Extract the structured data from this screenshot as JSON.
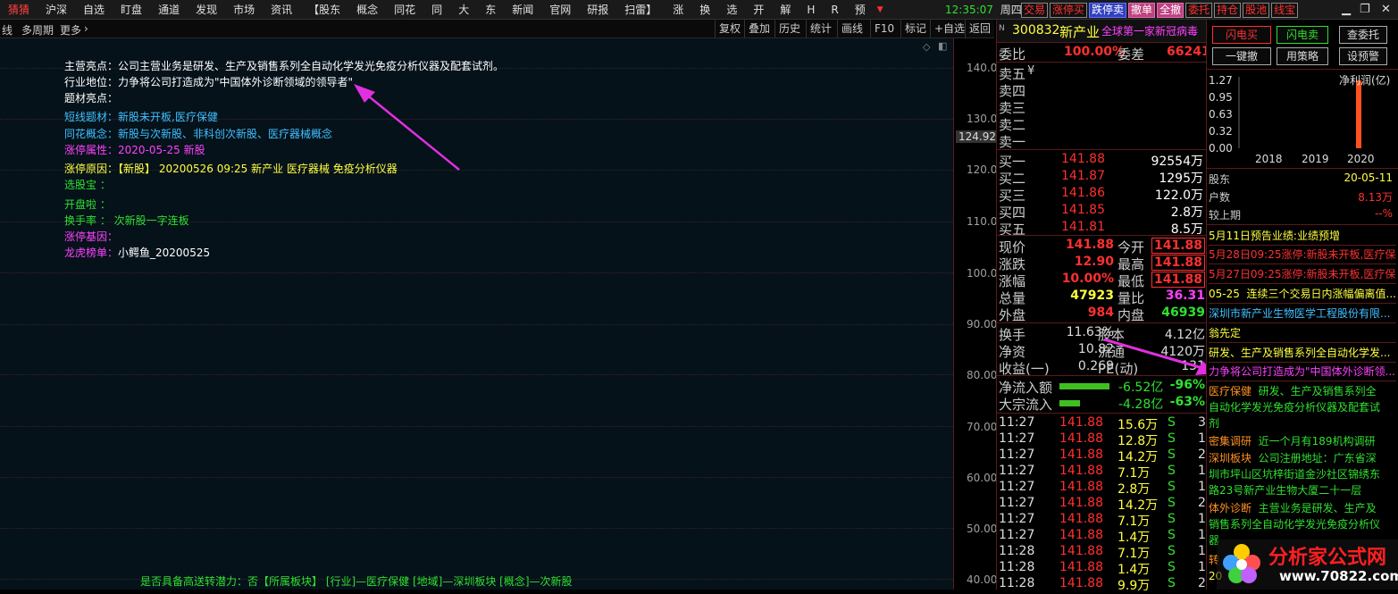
{
  "menu": {
    "items": [
      "猜猜",
      "沪深",
      "自选",
      "盯盘",
      "通道",
      "发现",
      "市场",
      "资讯",
      "【股东",
      "概念",
      "同花",
      "同",
      "大",
      "东",
      "新闻",
      "官网",
      "研报",
      "扫雷】",
      "涨",
      "换",
      "选",
      "开",
      "解",
      "H",
      "R",
      "预"
    ],
    "arrow": "▼"
  },
  "clock": {
    "time": "12:35:07",
    "weekday": "周四"
  },
  "rbuttons": [
    "交易",
    "涨停买",
    "跌停卖",
    "撤单",
    "全撤",
    "委托",
    "持仓",
    "股池",
    "线宝"
  ],
  "window": {
    "min": "▁",
    "restore": "❐",
    "close": "✕"
  },
  "toolbar": {
    "left": [
      "线",
      "多周期",
      "更多",
      "›"
    ],
    "right": [
      "复权",
      "叠加",
      "历史",
      "统计",
      "画线",
      "F10",
      "标记",
      "+自选",
      "返回"
    ]
  },
  "info": {
    "l1": "主营亮点：公司主营业务是研发、生产及销售系列全自动化学发光免疫分析仪器及配套试剂。",
    "l2": "行业地位：力争将公司打造成为\"中国体外诊断领域的领导者\"",
    "l3": "题材亮点：",
    "l4a": "短线题材：",
    "l4b": "新股未开板,医疗保健",
    "l5a": "同花概念：",
    "l5b": "新股与次新股、非科创次新股、医疗器械概念",
    "l6a": "涨停属性：",
    "l6b": "2020-05-25 新股",
    "l7a": "涨停原因：",
    "l7b": "【新股】 20200526 09:25 新产业  医疗器械 免疫分析仪器",
    "l8": "选股宝 ：",
    "l9": "开盘啦 ：",
    "l10a": "换手率 ：",
    "l10b": "次新股一字连板",
    "l11": "涨停基因：",
    "l12a": "龙虎榜单：",
    "l12b": "小鳄鱼_20200525",
    "bottom": "是否具备高送转潜力：否【所属板块】 [行业]—医疗保健 [地域]—深圳板块 [概念]—次新股"
  },
  "yaxis": {
    "ticks": [
      "140.0",
      "130.0",
      "120.0",
      "110.0",
      "100.0",
      "90.00",
      "80.00",
      "70.00",
      "60.00",
      "50.00",
      "40.00"
    ],
    "current": "124.92"
  },
  "quote": {
    "code": "300832",
    "name": "新产业",
    "note": "全球第一家新冠病毒",
    "weibi_l": "委比",
    "weibi_v": "100.00%",
    "weicha_l": "委差",
    "weicha_v": "66241",
    "sell": [
      [
        "卖五",
        "¥"
      ],
      [
        "卖四",
        ""
      ],
      [
        "卖三",
        ""
      ],
      [
        "卖二",
        ""
      ],
      [
        "卖一",
        ""
      ]
    ],
    "buy": [
      [
        "买一",
        "141.88",
        "92554万"
      ],
      [
        "买二",
        "141.87",
        "1295万"
      ],
      [
        "买三",
        "141.86",
        "122.0万"
      ],
      [
        "买四",
        "141.85",
        "2.8万"
      ],
      [
        "买五",
        "141.81",
        "8.5万"
      ]
    ],
    "stats": [
      [
        "现价",
        "141.88",
        "今开",
        "141.88"
      ],
      [
        "涨跌",
        "12.90",
        "最高",
        "141.88"
      ],
      [
        "涨幅",
        "10.00%",
        "最低",
        "141.88"
      ],
      [
        "总量",
        "47923",
        "量比",
        "36.31"
      ],
      [
        "外盘",
        "984",
        "内盘",
        "46939"
      ]
    ],
    "stats2": [
      [
        "换手",
        "11.63%",
        "股本",
        "4.12亿"
      ],
      [
        "净资",
        "10.82",
        "流通",
        "4120万"
      ],
      [
        "收益(一)",
        "0.269",
        "PE(动)",
        "131"
      ]
    ],
    "flow": [
      [
        "净流入额",
        "-6.52亿",
        "-96%"
      ],
      [
        "大宗流入",
        "-4.28亿",
        "-63%"
      ]
    ],
    "ticks": [
      [
        "11:27",
        "141.88",
        "15.6万",
        "S",
        "3"
      ],
      [
        "11:27",
        "141.88",
        "12.8万",
        "S",
        "1"
      ],
      [
        "11:27",
        "141.88",
        "14.2万",
        "S",
        "2"
      ],
      [
        "11:27",
        "141.88",
        "7.1万",
        "S",
        "1"
      ],
      [
        "11:27",
        "141.88",
        "2.8万",
        "S",
        "1"
      ],
      [
        "11:27",
        "141.88",
        "14.2万",
        "S",
        "2"
      ],
      [
        "11:27",
        "141.88",
        "7.1万",
        "S",
        "1"
      ],
      [
        "11:27",
        "141.88",
        "1.4万",
        "S",
        "1"
      ],
      [
        "11:28",
        "141.88",
        "7.1万",
        "S",
        "1"
      ],
      [
        "11:28",
        "141.88",
        "1.4万",
        "S",
        "1"
      ],
      [
        "11:28",
        "141.88",
        "9.9万",
        "S",
        "2"
      ]
    ]
  },
  "side": {
    "b1": "闪电买",
    "b2": "闪电卖",
    "b3": "查委托",
    "b4": "一键撤",
    "b5": "用策略",
    "b6": "设预警",
    "chart_data": {
      "type": "bar",
      "title": "净利润(亿)",
      "categories": [
        "2018",
        "2019",
        "2020"
      ],
      "values": [
        0,
        0,
        1.27
      ],
      "yticks": [
        "1.27",
        "0.95",
        "0.63",
        "0.32",
        "0.00"
      ],
      "ylim": [
        0,
        1.27
      ]
    },
    "holder_l": "股东",
    "holder_v": "20-05-11",
    "hushu_l": "户数",
    "hushu_v": "8.13万",
    "jsq_l": "较上期",
    "jsq_v": "--%",
    "n1": "5月11日预告业绩:业绩预增",
    "n2": "5月28日09:25涨停:新股未开板,医疗保...",
    "n3": "5月27日09:25涨停:新股未开板,医疗保...",
    "n4a": "05-25",
    "n4b": "连续三个交易日内涨幅偏离值...",
    "n5": "深圳市新产业生物医学工程股份有限...",
    "n6": "翁先定",
    "n7": "研发、生产及销售系列全自动化学发...",
    "n8": "力争将公司打造成为\"中国体外诊断领...",
    "t1a": "医疗保健",
    "t1b": "研发、生产及销售系列全",
    "t1c": "自动化学发光免疫分析仪器及配套试",
    "t1d": "剂",
    "t2a": "密集调研",
    "t2b": "近一个月有189机构调研",
    "t3a": "深圳板块",
    "t3b": "公司注册地址：广东省深",
    "t3c": "圳市坪山区坑梓街道金沙社区锦绣东",
    "t3d": "路23号新产业生物大厦二十一层",
    "t4a": "体外诊断",
    "t4b": "主营业务是研发、生产及",
    "t4c": "销售系列全自动化学发光免疫分析仪",
    "t4d": "器",
    "t5": "转",
    "t6": "20"
  },
  "watermark": {
    "title": "分析家公式网",
    "url": "www.70822.com"
  },
  "colors": {
    "red": "#ff3030",
    "green": "#30e030",
    "yellow": "#ffff40",
    "cyan": "#40c0ff",
    "magenta": "#ff40ff",
    "orange": "#ff9020",
    "arrow": "#e030e0"
  }
}
